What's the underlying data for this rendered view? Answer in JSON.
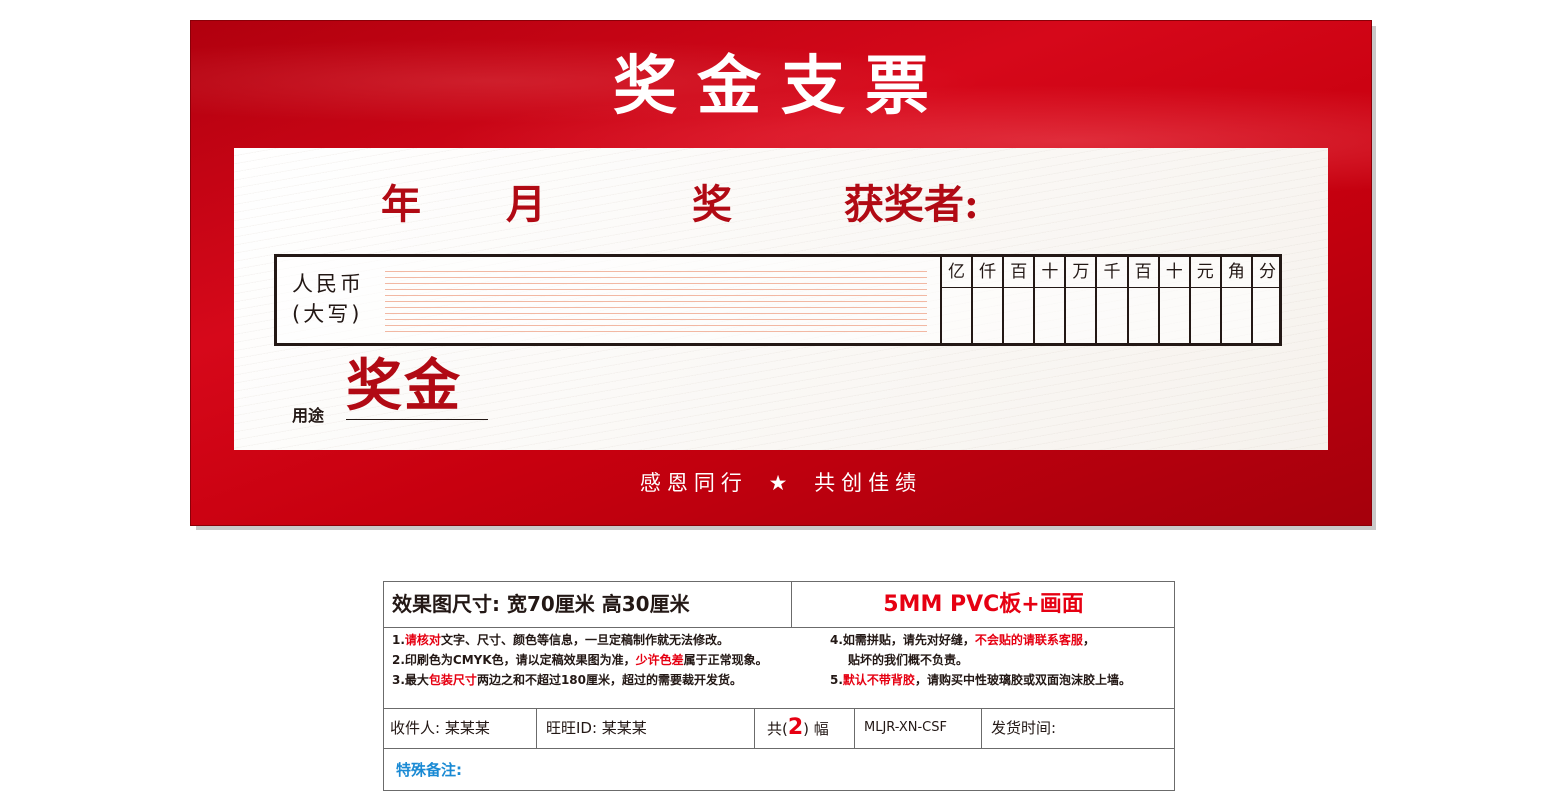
{
  "check": {
    "title": "奖金支票",
    "date_year": "年",
    "date_month": "月",
    "award": "奖",
    "recipient_label": "获奖者:",
    "rmb_label_line1": "人民币",
    "rmb_label_line2": "(大写)",
    "digit_units": [
      "亿",
      "仟",
      "百",
      "十",
      "万",
      "千",
      "百",
      "十",
      "元",
      "角",
      "分"
    ],
    "purpose_label": "用途",
    "purpose_value": "奖金",
    "slogan_left": "感恩同行",
    "slogan_star": "★",
    "slogan_right": "共创佳绩",
    "colors": {
      "board": "#c8000f",
      "accent": "#b10a14"
    }
  },
  "spec": {
    "size": "效果图尺寸:  宽70厘米  高30厘米",
    "material": "5MM PVC板+画面",
    "notes": {
      "n1_pre": "1.",
      "n1_red": "请核对",
      "n1_post": "文字、尺寸、颜色等信息，一旦定稿制作就无法修改。",
      "n2_pre": "2.印刷色为CMYK色，请以定稿效果图为准，",
      "n2_red": "少许色差",
      "n2_post": "属于正常现象。",
      "n3_pre": "3.最大",
      "n3_red": "包装尺寸",
      "n3_post": "两边之和不超过180厘米，超过的需要裁开发货。",
      "n4_pre": "4.如需拼贴，请先对好缝，",
      "n4_red": "不会贴的请联系客服",
      "n4_post": "，",
      "n4_line2": "贴坏的我们概不负责。",
      "n5_pre": "5.",
      "n5_red": "默认不带背胶",
      "n5_post": "，请购买中性玻璃胶或双面泡沫胶上墙。"
    },
    "recipient": "收件人: 某某某",
    "wangwang": "旺旺ID:  某某某",
    "count_pre": "共(",
    "count_num": "2",
    "count_post": ") 幅",
    "code": "MLJR-XN-CSF",
    "ship_time": "发货时间:",
    "remark": "特殊备注:",
    "colors": {
      "highlight": "#e60012",
      "remark": "#1a8ad4"
    }
  }
}
